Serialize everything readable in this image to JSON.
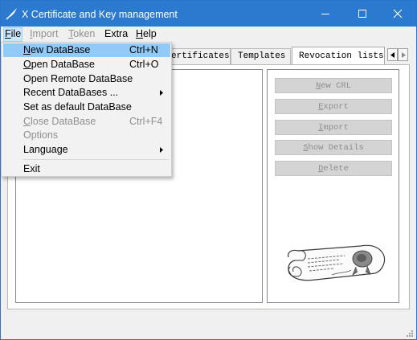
{
  "window": {
    "title": "X Certificate and Key management",
    "accent_color": "#2b7ad0",
    "icon": "quill-icon"
  },
  "menubar": {
    "items": [
      {
        "label": "File",
        "mnemonic": "F",
        "rest": "ile",
        "state": "open"
      },
      {
        "label": "Import",
        "mnemonic": "I",
        "rest": "mport",
        "state": "disabled"
      },
      {
        "label": "Token",
        "mnemonic": "T",
        "rest": "oken",
        "state": "disabled"
      },
      {
        "label": "Extra",
        "state": "normal"
      },
      {
        "label": "Help",
        "mnemonic": "H",
        "rest": "elp",
        "state": "normal"
      }
    ]
  },
  "tabs": {
    "items": [
      {
        "label": "Certificates"
      },
      {
        "label": "Templates"
      },
      {
        "label": "Revocation lists",
        "selected": true
      }
    ],
    "visible_partial_label": "ertificates"
  },
  "file_menu": {
    "items": [
      {
        "label": "New DataBase",
        "mnemonic": "N",
        "rest": "ew DataBase",
        "shortcut": "Ctrl+N",
        "highlighted": true
      },
      {
        "label": "Open DataBase",
        "mnemonic": "O",
        "rest": "pen DataBase",
        "shortcut": "Ctrl+O"
      },
      {
        "label": "Open Remote DataBase"
      },
      {
        "label": "Recent DataBases ...",
        "submenu": true
      },
      {
        "label": "Set as default DataBase"
      },
      {
        "label": "Close DataBase",
        "mnemonic": "C",
        "rest": "lose DataBase",
        "shortcut": "Ctrl+F4",
        "disabled": true
      },
      {
        "label": "Options",
        "disabled": true
      },
      {
        "label": "Language",
        "submenu": true
      },
      {
        "label": "Exit"
      }
    ]
  },
  "crl_actions": {
    "buttons": [
      {
        "label": "New CRL",
        "mnemonic": "N",
        "rest": "ew CRL"
      },
      {
        "label": "Export",
        "mnemonic": "E",
        "rest": "xport"
      },
      {
        "label": "Import",
        "mnemonic": "I",
        "rest": "mport"
      },
      {
        "label": "Show Details",
        "mnemonic": "S",
        "rest": "how Details"
      },
      {
        "label": "Delete",
        "mnemonic": "D",
        "rest": "elete"
      }
    ],
    "state": "disabled",
    "illustration": "parchment-scroll-icon"
  }
}
